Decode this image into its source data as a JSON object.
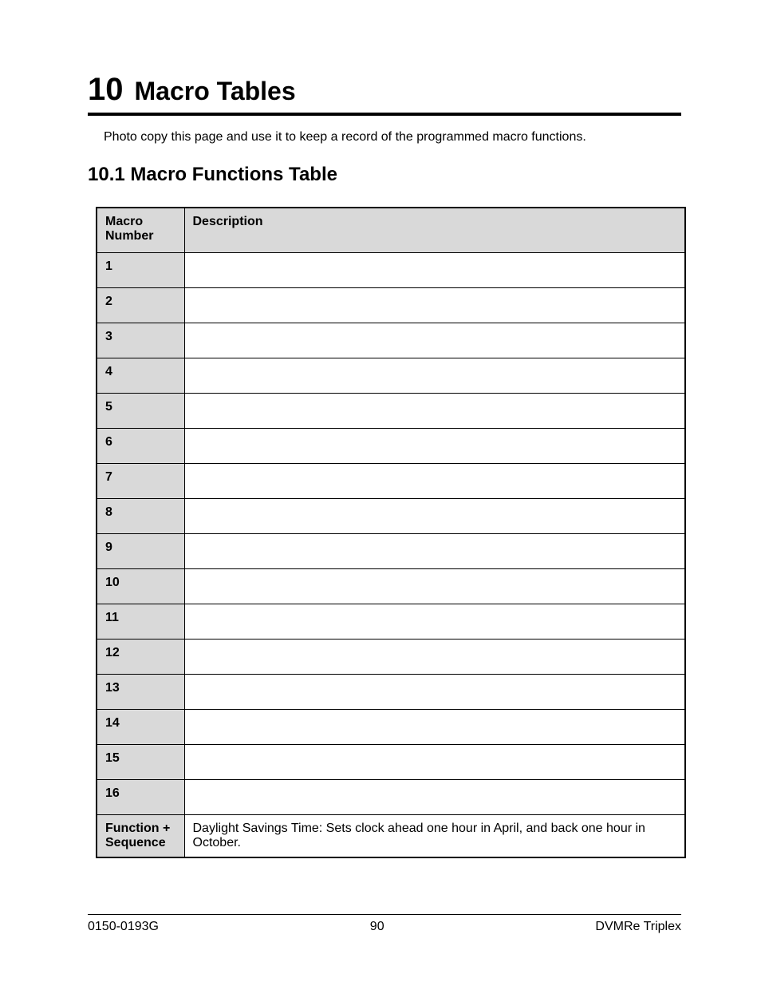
{
  "chapter": {
    "number": "10",
    "title": "Macro Tables"
  },
  "intro": "Photo copy this page and use it to keep a record of the programmed macro functions.",
  "section": {
    "heading": "10.1 Macro Functions Table"
  },
  "table": {
    "headers": {
      "col1": "Macro Number",
      "col2": "Description"
    },
    "rows": [
      {
        "num": "1",
        "desc": ""
      },
      {
        "num": "2",
        "desc": ""
      },
      {
        "num": "3",
        "desc": ""
      },
      {
        "num": "4",
        "desc": ""
      },
      {
        "num": "5",
        "desc": ""
      },
      {
        "num": "6",
        "desc": ""
      },
      {
        "num": "7",
        "desc": ""
      },
      {
        "num": "8",
        "desc": ""
      },
      {
        "num": "9",
        "desc": ""
      },
      {
        "num": "10",
        "desc": ""
      },
      {
        "num": "11",
        "desc": ""
      },
      {
        "num": "12",
        "desc": ""
      },
      {
        "num": "13",
        "desc": ""
      },
      {
        "num": "14",
        "desc": ""
      },
      {
        "num": "15",
        "desc": ""
      },
      {
        "num": "16",
        "desc": ""
      }
    ],
    "footer_row": {
      "label": "Function + Sequence",
      "desc": "Daylight Savings Time:  Sets clock ahead one hour in April, and back one hour in October."
    }
  },
  "page_footer": {
    "left": "0150-0193G",
    "center": "90",
    "right": "DVMRe Triplex"
  }
}
